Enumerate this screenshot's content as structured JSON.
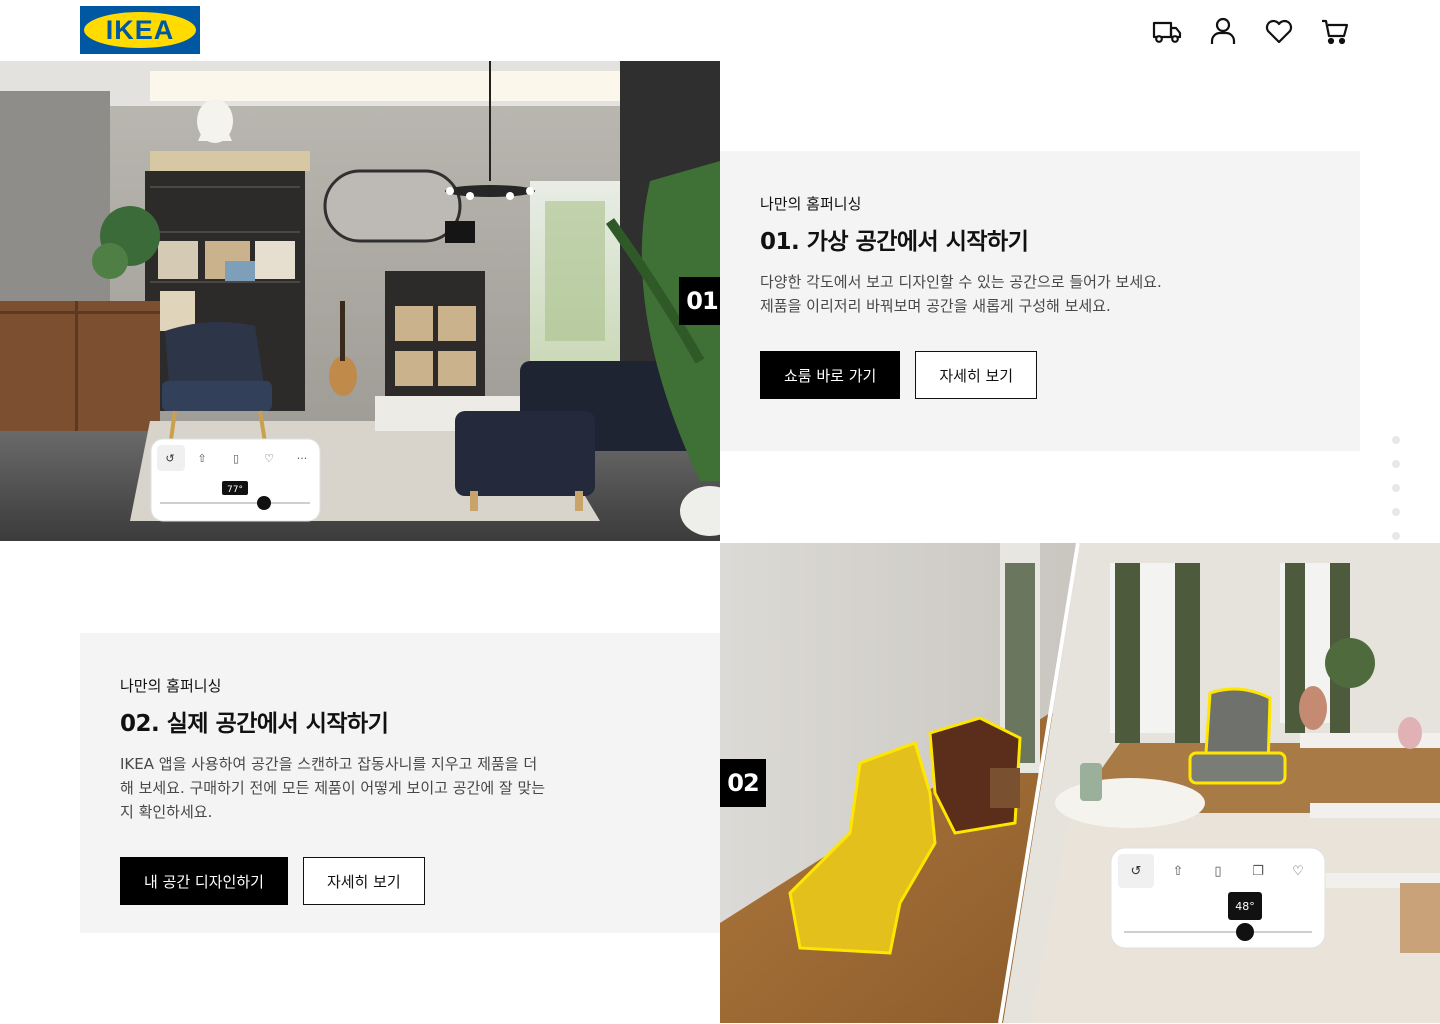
{
  "header": {
    "logo_text": "IKEA",
    "brand_colors": {
      "blue": "#0058a3",
      "yellow": "#ffdb00"
    },
    "icons": [
      "delivery-truck-icon",
      "user-icon",
      "heart-icon",
      "cart-icon"
    ]
  },
  "section1": {
    "number": "01",
    "eyebrow": "나만의 홈퍼니싱",
    "title": "01. 가상 공간에서 시작하기",
    "description": "다양한 각도에서 보고 디자인할 수 있는 공간으로 들어가 보세요. 제품을 이리저리 바꿔보며 공간을 새롭게 구성해 보세요.",
    "primary_button": "쇼룸 바로 가기",
    "secondary_button": "자세히 보기",
    "image_overlay_angle": "77°"
  },
  "section2": {
    "number": "02",
    "eyebrow": "나만의 홈퍼니싱",
    "title": "02. 실제 공간에서 시작하기",
    "description": "IKEA 앱을 사용하여 공간을 스캔하고 잡동사니를 지우고 제품을 더해 보세요. 구매하기 전에 모든 제품이 어떻게 보이고 공간에 잘 맞는지 확인하세요.",
    "primary_button": "내 공간 디자인하기",
    "secondary_button": "자세히 보기",
    "image_overlay_angle": "48°"
  },
  "pager": {
    "total": 7,
    "active_index": 5
  }
}
